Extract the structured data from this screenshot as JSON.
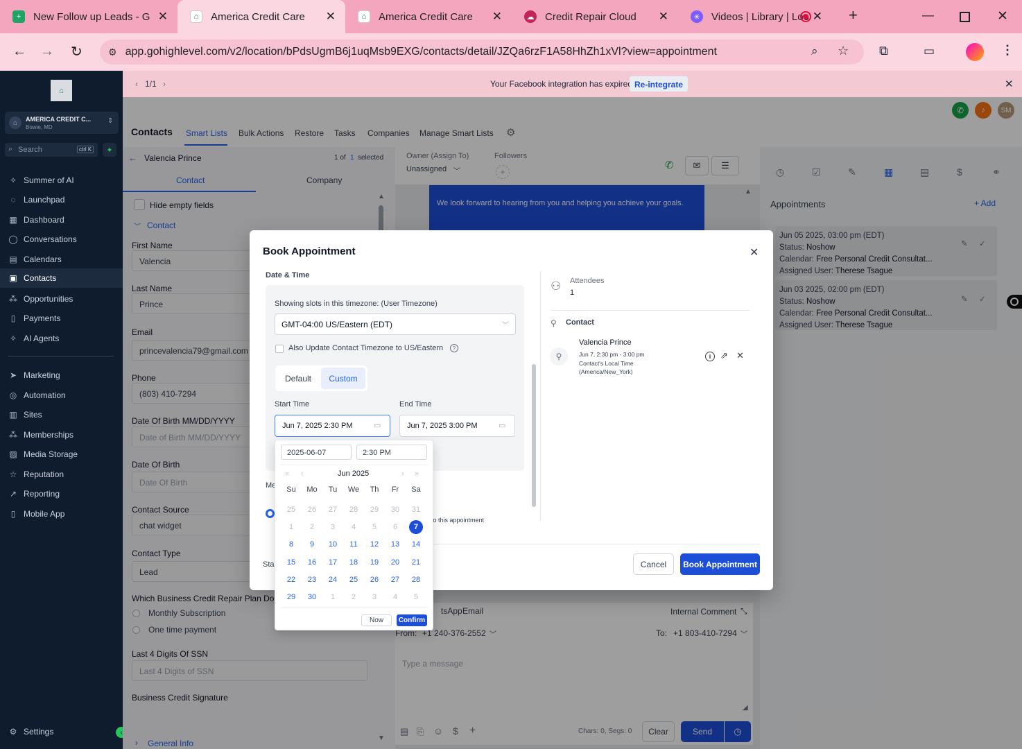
{
  "browser": {
    "tabs": [
      {
        "title": "New Follow up Leads - G"
      },
      {
        "title": "America Credit Care"
      },
      {
        "title": "America Credit Care"
      },
      {
        "title": "Credit Repair Cloud"
      },
      {
        "title": "Videos | Library | Loo"
      }
    ],
    "url": "app.gohighlevel.com/v2/location/bPdsUgmB6j1uqMsb9EXG/contacts/detail/JZQa6rzF1A58HhZh1xVl?view=appointment"
  },
  "sidebar": {
    "account_name": "AMERICA CREDIT C...",
    "account_location": "Bowie, MD",
    "search_placeholder": "Search",
    "search_shortcut": "ctrl K",
    "items": [
      {
        "label": "Summer of AI"
      },
      {
        "label": "Launchpad"
      },
      {
        "label": "Dashboard"
      },
      {
        "label": "Conversations"
      },
      {
        "label": "Calendars"
      },
      {
        "label": "Contacts"
      },
      {
        "label": "Opportunities"
      },
      {
        "label": "Payments"
      },
      {
        "label": "AI Agents"
      },
      {
        "label": "Marketing"
      },
      {
        "label": "Automation"
      },
      {
        "label": "Sites"
      },
      {
        "label": "Memberships"
      },
      {
        "label": "Media Storage"
      },
      {
        "label": "Reputation"
      },
      {
        "label": "Reporting"
      },
      {
        "label": "Mobile App"
      }
    ],
    "settings": "Settings"
  },
  "banner": {
    "pager": "1/1",
    "message": "Your Facebook integration has expired.",
    "action": "Re-integrate"
  },
  "header": {
    "avatar": "SM"
  },
  "topnav": {
    "title": "Contacts",
    "items": [
      "Smart Lists",
      "Bulk Actions",
      "Restore",
      "Tasks",
      "Companies",
      "Manage Smart Lists"
    ]
  },
  "contact": {
    "name": "Valencia Prince",
    "count_prefix": "1 of",
    "count_num": "1",
    "count_suffix": "selected",
    "tabs": [
      "Contact",
      "Company"
    ],
    "hide_empty": "Hide empty fields",
    "section": "Contact",
    "fields": [
      {
        "label": "First Name",
        "value": "Valencia"
      },
      {
        "label": "Last Name",
        "value": "Prince"
      },
      {
        "label": "Email",
        "value": "princevalencia79@gmail.com"
      },
      {
        "label": "Phone",
        "value": "(803) 410-7294"
      },
      {
        "label": "Date Of Birth MM/DD/YYYY",
        "placeholder": "Date of Birth MM/DD/YYYY"
      },
      {
        "label": "Date Of Birth",
        "placeholder": "Date Of Birth"
      },
      {
        "label": "Contact Source",
        "value": "chat widget"
      },
      {
        "label": "Contact Type",
        "value": "Lead"
      }
    ],
    "plan_question": "Which Business Credit Repair Plan Do You",
    "plan_options": [
      "Monthly Subscription",
      "One time payment"
    ],
    "ssn_label": "Last 4 Digits Of SSN",
    "ssn_placeholder": "Last 4 Digits of SSN",
    "signature_label": "Business Credit Signature",
    "general_info": "General Info"
  },
  "conversation": {
    "owner_label": "Owner (Assign To)",
    "owner_value": "Unassigned",
    "followers_label": "Followers",
    "message_bubble": "We look forward to hearing from you and helping you achieve your goals.",
    "channels": [
      "tsApp",
      "Email"
    ],
    "internal_comment": "Internal Comment",
    "from_label": "From:",
    "from_value": "+1 240-376-2552",
    "to_label": "To:",
    "to_value": "+1 803-410-7294",
    "placeholder": "Type a message",
    "chars": "Chars: 0, Segs: 0",
    "clear": "Clear",
    "send": "Send"
  },
  "appointments": {
    "title": "Appointments",
    "add": "+ Add",
    "items": [
      {
        "datetime": "Jun 05 2025, 03:00 pm (EDT)",
        "status_label": "Status:",
        "status": "Noshow",
        "calendar_label": "Calendar:",
        "calendar": "Free Personal Credit Consultat...",
        "user_label": "Assigned User:",
        "user": "Therese Tsague"
      },
      {
        "datetime": "Jun 03 2025, 02:00 pm (EDT)",
        "status_label": "Status:",
        "status": "Noshow",
        "calendar_label": "Calendar:",
        "calendar": "Free Personal Credit Consultat...",
        "user_label": "Assigned User:",
        "user": "Therese Tsague"
      }
    ]
  },
  "modal": {
    "title": "Book Appointment",
    "section_label": "Date & Time",
    "tz_label": "Showing slots in this timezone: (User Timezone)",
    "tz_value": "GMT-04:00 US/Eastern (EDT)",
    "update_tz": "Also Update Contact Timezone to US/Eastern",
    "toggle": [
      "Default",
      "Custom"
    ],
    "start_label": "Start Time",
    "start_value": "Jun 7, 2025 2:30 PM",
    "end_label": "End Time",
    "end_value": "Jun 7, 2025 3:00 PM",
    "hidden_label_1": "Me",
    "hidden_label_2": "Sta",
    "hidden_text": "to this appointment",
    "attendees_label": "Attendees",
    "attendees_count": "1",
    "contact_label": "Contact",
    "attendee_name": "Valencia Prince",
    "attendee_time": "Jun 7, 2:30 pm - 3:00 pm",
    "attendee_local": "Contact's Local Time",
    "attendee_zone": "(America/New_York)",
    "cancel": "Cancel",
    "book": "Book Appointment"
  },
  "datepicker": {
    "date_input": "2025-06-07",
    "time_input": "2:30 PM",
    "month_label": "Jun 2025",
    "weekdays": [
      "Su",
      "Mo",
      "Tu",
      "We",
      "Th",
      "Fr",
      "Sa"
    ],
    "weeks": [
      [
        "25",
        "26",
        "27",
        "28",
        "29",
        "30",
        "31"
      ],
      [
        "1",
        "2",
        "3",
        "4",
        "5",
        "6",
        "7"
      ],
      [
        "8",
        "9",
        "10",
        "11",
        "12",
        "13",
        "14"
      ],
      [
        "15",
        "16",
        "17",
        "18",
        "19",
        "20",
        "21"
      ],
      [
        "22",
        "23",
        "24",
        "25",
        "26",
        "27",
        "28"
      ],
      [
        "29",
        "30",
        "1",
        "2",
        "3",
        "4",
        "5"
      ]
    ],
    "selected": "7",
    "now": "Now",
    "confirm": "Confirm"
  },
  "colors": {
    "accent": "#2563eb",
    "sidebar_bg": "#0f1c2e",
    "tabbar": "#f3a6bd",
    "book_button": "#1d4ed8"
  }
}
